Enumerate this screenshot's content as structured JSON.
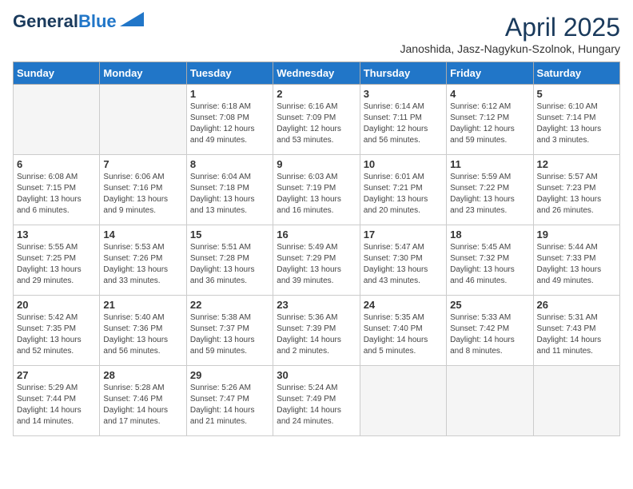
{
  "header": {
    "logo_line1": "General",
    "logo_line2": "Blue",
    "month_title": "April 2025",
    "subtitle": "Janoshida, Jasz-Nagykun-Szolnok, Hungary"
  },
  "days_of_week": [
    "Sunday",
    "Monday",
    "Tuesday",
    "Wednesday",
    "Thursday",
    "Friday",
    "Saturday"
  ],
  "weeks": [
    [
      {
        "day": "",
        "empty": true
      },
      {
        "day": "",
        "empty": true
      },
      {
        "day": "1",
        "sunrise": "6:18 AM",
        "sunset": "7:08 PM",
        "daylight": "12 hours and 49 minutes."
      },
      {
        "day": "2",
        "sunrise": "6:16 AM",
        "sunset": "7:09 PM",
        "daylight": "12 hours and 53 minutes."
      },
      {
        "day": "3",
        "sunrise": "6:14 AM",
        "sunset": "7:11 PM",
        "daylight": "12 hours and 56 minutes."
      },
      {
        "day": "4",
        "sunrise": "6:12 AM",
        "sunset": "7:12 PM",
        "daylight": "12 hours and 59 minutes."
      },
      {
        "day": "5",
        "sunrise": "6:10 AM",
        "sunset": "7:14 PM",
        "daylight": "13 hours and 3 minutes."
      }
    ],
    [
      {
        "day": "6",
        "sunrise": "6:08 AM",
        "sunset": "7:15 PM",
        "daylight": "13 hours and 6 minutes."
      },
      {
        "day": "7",
        "sunrise": "6:06 AM",
        "sunset": "7:16 PM",
        "daylight": "13 hours and 9 minutes."
      },
      {
        "day": "8",
        "sunrise": "6:04 AM",
        "sunset": "7:18 PM",
        "daylight": "13 hours and 13 minutes."
      },
      {
        "day": "9",
        "sunrise": "6:03 AM",
        "sunset": "7:19 PM",
        "daylight": "13 hours and 16 minutes."
      },
      {
        "day": "10",
        "sunrise": "6:01 AM",
        "sunset": "7:21 PM",
        "daylight": "13 hours and 20 minutes."
      },
      {
        "day": "11",
        "sunrise": "5:59 AM",
        "sunset": "7:22 PM",
        "daylight": "13 hours and 23 minutes."
      },
      {
        "day": "12",
        "sunrise": "5:57 AM",
        "sunset": "7:23 PM",
        "daylight": "13 hours and 26 minutes."
      }
    ],
    [
      {
        "day": "13",
        "sunrise": "5:55 AM",
        "sunset": "7:25 PM",
        "daylight": "13 hours and 29 minutes."
      },
      {
        "day": "14",
        "sunrise": "5:53 AM",
        "sunset": "7:26 PM",
        "daylight": "13 hours and 33 minutes."
      },
      {
        "day": "15",
        "sunrise": "5:51 AM",
        "sunset": "7:28 PM",
        "daylight": "13 hours and 36 minutes."
      },
      {
        "day": "16",
        "sunrise": "5:49 AM",
        "sunset": "7:29 PM",
        "daylight": "13 hours and 39 minutes."
      },
      {
        "day": "17",
        "sunrise": "5:47 AM",
        "sunset": "7:30 PM",
        "daylight": "13 hours and 43 minutes."
      },
      {
        "day": "18",
        "sunrise": "5:45 AM",
        "sunset": "7:32 PM",
        "daylight": "13 hours and 46 minutes."
      },
      {
        "day": "19",
        "sunrise": "5:44 AM",
        "sunset": "7:33 PM",
        "daylight": "13 hours and 49 minutes."
      }
    ],
    [
      {
        "day": "20",
        "sunrise": "5:42 AM",
        "sunset": "7:35 PM",
        "daylight": "13 hours and 52 minutes."
      },
      {
        "day": "21",
        "sunrise": "5:40 AM",
        "sunset": "7:36 PM",
        "daylight": "13 hours and 56 minutes."
      },
      {
        "day": "22",
        "sunrise": "5:38 AM",
        "sunset": "7:37 PM",
        "daylight": "13 hours and 59 minutes."
      },
      {
        "day": "23",
        "sunrise": "5:36 AM",
        "sunset": "7:39 PM",
        "daylight": "14 hours and 2 minutes."
      },
      {
        "day": "24",
        "sunrise": "5:35 AM",
        "sunset": "7:40 PM",
        "daylight": "14 hours and 5 minutes."
      },
      {
        "day": "25",
        "sunrise": "5:33 AM",
        "sunset": "7:42 PM",
        "daylight": "14 hours and 8 minutes."
      },
      {
        "day": "26",
        "sunrise": "5:31 AM",
        "sunset": "7:43 PM",
        "daylight": "14 hours and 11 minutes."
      }
    ],
    [
      {
        "day": "27",
        "sunrise": "5:29 AM",
        "sunset": "7:44 PM",
        "daylight": "14 hours and 14 minutes."
      },
      {
        "day": "28",
        "sunrise": "5:28 AM",
        "sunset": "7:46 PM",
        "daylight": "14 hours and 17 minutes."
      },
      {
        "day": "29",
        "sunrise": "5:26 AM",
        "sunset": "7:47 PM",
        "daylight": "14 hours and 21 minutes."
      },
      {
        "day": "30",
        "sunrise": "5:24 AM",
        "sunset": "7:49 PM",
        "daylight": "14 hours and 24 minutes."
      },
      {
        "day": "",
        "empty": true
      },
      {
        "day": "",
        "empty": true
      },
      {
        "day": "",
        "empty": true
      }
    ]
  ]
}
